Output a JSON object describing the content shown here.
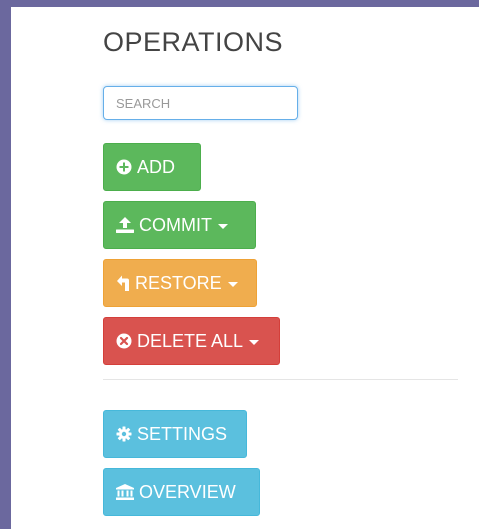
{
  "panel": {
    "title": "OPERATIONS",
    "search": {
      "placeholder": "SEARCH"
    },
    "buttons": {
      "add": {
        "label": "ADD",
        "icon": "plus-circle-icon"
      },
      "commit": {
        "label": "COMMIT",
        "icon": "upload-icon"
      },
      "restore": {
        "label": "RESTORE",
        "icon": "restore-icon"
      },
      "delete_all": {
        "label": "DELETE ALL",
        "icon": "remove-circle-icon"
      },
      "settings": {
        "label": "SETTINGS",
        "icon": "gear-icon"
      },
      "overview": {
        "label": "OVERVIEW",
        "icon": "bank-icon"
      }
    }
  },
  "colors": {
    "background": "#6b689e",
    "success": "#5cb85c",
    "warning": "#f0ad4e",
    "danger": "#d9534f",
    "info": "#5bc0de"
  }
}
